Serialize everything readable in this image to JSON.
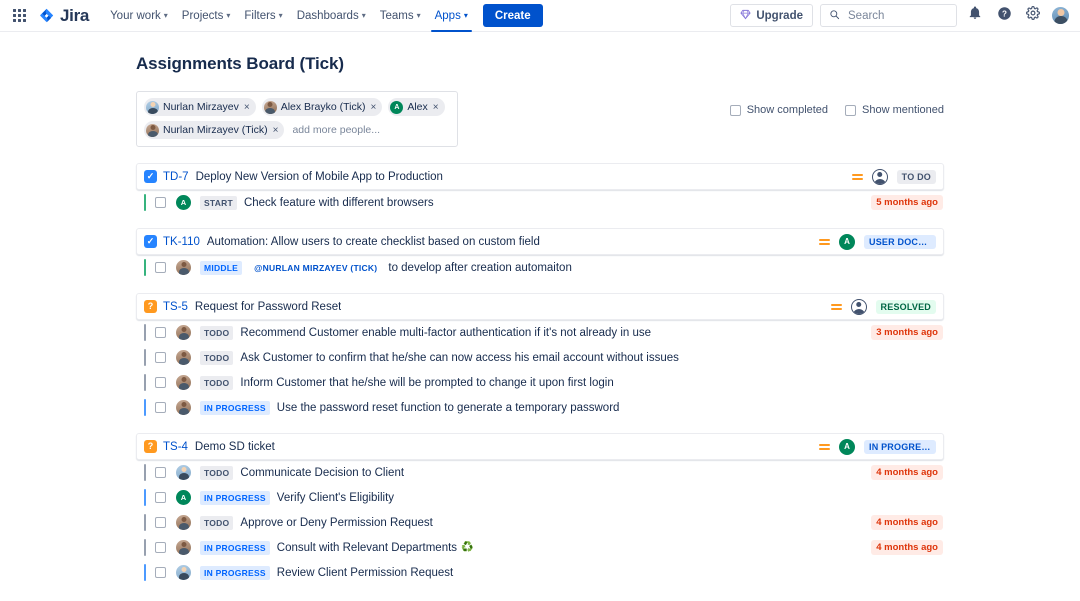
{
  "nav": {
    "app_switcher_icon": "grid-apps-icon",
    "logo_text": "Jira",
    "items": [
      {
        "label": "Your work",
        "has_caret": true,
        "active": false
      },
      {
        "label": "Projects",
        "has_caret": true,
        "active": false
      },
      {
        "label": "Filters",
        "has_caret": true,
        "active": false
      },
      {
        "label": "Dashboards",
        "has_caret": true,
        "active": false
      },
      {
        "label": "Teams",
        "has_caret": true,
        "active": false
      },
      {
        "label": "Apps",
        "has_caret": true,
        "active": true
      }
    ],
    "create_label": "Create",
    "upgrade_label": "Upgrade",
    "upgrade_icon": "diamond-icon",
    "search_placeholder": "Search",
    "search_value": "",
    "search_icon": "search-icon",
    "notifications_icon": "bell-icon",
    "help_icon": "help-circle-icon",
    "settings_icon": "gear-icon",
    "profile_icon": "user-avatar"
  },
  "page": {
    "title": "Assignments Board (Tick)"
  },
  "people_picker": {
    "placeholder": "add more people...",
    "chips": [
      {
        "name": "Nurlan Mirzayev",
        "avatar": "blue-photo",
        "remove_label": "×"
      },
      {
        "name": "Alex Brayko (Tick)",
        "avatar": "brown-photo",
        "remove_label": "×"
      },
      {
        "name": "Alex",
        "avatar": "green-initial",
        "initial": "A",
        "remove_label": "×"
      },
      {
        "name": "Nurlan Mirzayev (Tick)",
        "avatar": "brown-photo",
        "remove_label": "×"
      }
    ]
  },
  "filters": {
    "show_completed": {
      "label": "Show completed",
      "checked": false
    },
    "show_mentioned": {
      "label": "Show mentioned",
      "checked": false
    }
  },
  "issues": [
    {
      "type_icon": "task-icon",
      "type_glyph": "✓",
      "type_class": "type-task",
      "key": "TD-7",
      "summary": "Deploy New Version of Mobile App to Production",
      "priority_icon": "medium-priority-icon",
      "assignee": {
        "kind": "unassigned",
        "initial": ""
      },
      "status": {
        "label": "TO DO",
        "class": "st-todo"
      },
      "subtasks": [
        {
          "accent": "ac-green",
          "checked": false,
          "avatar": "green-initial",
          "initial": "A",
          "label": "START",
          "label_class": "lb-gray",
          "mention": "",
          "text": "Check feature with different browsers",
          "recycle": false,
          "time": "5 months ago"
        }
      ]
    },
    {
      "type_icon": "task-icon",
      "type_glyph": "✓",
      "type_class": "type-task",
      "key": "TK-110",
      "summary": "Automation: Allow users to create checklist based on custom field",
      "priority_icon": "medium-priority-icon",
      "assignee": {
        "kind": "initial",
        "initial": "A"
      },
      "status": {
        "label": "USER DOCUM…",
        "class": "st-userdoc"
      },
      "subtasks": [
        {
          "accent": "ac-green",
          "checked": false,
          "avatar": "brown-photo",
          "initial": "",
          "label": "MIDDLE",
          "label_class": "lb-blue",
          "mention": "@NURLAN MIRZAYEV (TICK)",
          "text": "to develop after creation automaiton",
          "recycle": false,
          "time": ""
        }
      ]
    },
    {
      "type_icon": "service-request-icon",
      "type_glyph": "?",
      "type_class": "type-srv",
      "key": "TS-5",
      "summary": "Request for Password Reset",
      "priority_icon": "medium-priority-icon",
      "assignee": {
        "kind": "unassigned",
        "initial": ""
      },
      "status": {
        "label": "RESOLVED",
        "class": "st-resolved"
      },
      "subtasks": [
        {
          "accent": "ac-gray",
          "checked": false,
          "avatar": "brown-photo",
          "initial": "",
          "label": "TODO",
          "label_class": "lb-gray",
          "mention": "",
          "text": "Recommend Customer enable multi-factor authentication if it's not already in use",
          "recycle": false,
          "time": "3 months ago"
        },
        {
          "accent": "ac-gray",
          "checked": false,
          "avatar": "brown-photo",
          "initial": "",
          "label": "TODO",
          "label_class": "lb-gray",
          "mention": "",
          "text": "Ask Customer to confirm that he/she can now access his email account without issues",
          "recycle": false,
          "time": ""
        },
        {
          "accent": "ac-gray",
          "checked": false,
          "avatar": "brown-photo",
          "initial": "",
          "label": "TODO",
          "label_class": "lb-gray",
          "mention": "",
          "text": "Inform Customer that he/she will be prompted to change it upon first login",
          "recycle": false,
          "time": ""
        },
        {
          "accent": "ac-blue",
          "checked": false,
          "avatar": "brown-photo",
          "initial": "",
          "label": "IN PROGRESS",
          "label_class": "lb-blue",
          "mention": "",
          "text": "Use the password reset function to generate a temporary password",
          "recycle": false,
          "time": ""
        }
      ]
    },
    {
      "type_icon": "service-request-icon",
      "type_glyph": "?",
      "type_class": "type-srv",
      "key": "TS-4",
      "summary": "Demo SD ticket",
      "priority_icon": "medium-priority-icon",
      "assignee": {
        "kind": "initial",
        "initial": "A"
      },
      "status": {
        "label": "IN PROGRESS",
        "class": "st-inprogress"
      },
      "subtasks": [
        {
          "accent": "ac-gray",
          "checked": false,
          "avatar": "blue-photo",
          "initial": "",
          "label": "TODO",
          "label_class": "lb-gray",
          "mention": "",
          "text": "Communicate Decision to Client",
          "recycle": false,
          "time": "4 months ago"
        },
        {
          "accent": "ac-blue",
          "checked": false,
          "avatar": "green-initial",
          "initial": "A",
          "label": "IN PROGRESS",
          "label_class": "lb-blue",
          "mention": "",
          "text": "Verify Client's Eligibility",
          "recycle": false,
          "time": ""
        },
        {
          "accent": "ac-gray",
          "checked": false,
          "avatar": "brown-photo",
          "initial": "",
          "label": "TODO",
          "label_class": "lb-gray",
          "mention": "",
          "text": "Approve or Deny Permission Request",
          "recycle": false,
          "time": "4 months ago"
        },
        {
          "accent": "ac-gray",
          "checked": false,
          "avatar": "brown-photo",
          "initial": "",
          "label": "IN PROGRESS",
          "label_class": "lb-blue",
          "mention": "",
          "text": "Consult with Relevant Departments",
          "recycle": true,
          "recycle_glyph": "♻️",
          "time": "4 months ago"
        },
        {
          "accent": "ac-blue",
          "checked": false,
          "avatar": "blue-photo",
          "initial": "",
          "label": "IN PROGRESS",
          "label_class": "lb-blue",
          "mention": "",
          "text": "Review Client Permission Request",
          "recycle": false,
          "time": ""
        }
      ]
    }
  ]
}
